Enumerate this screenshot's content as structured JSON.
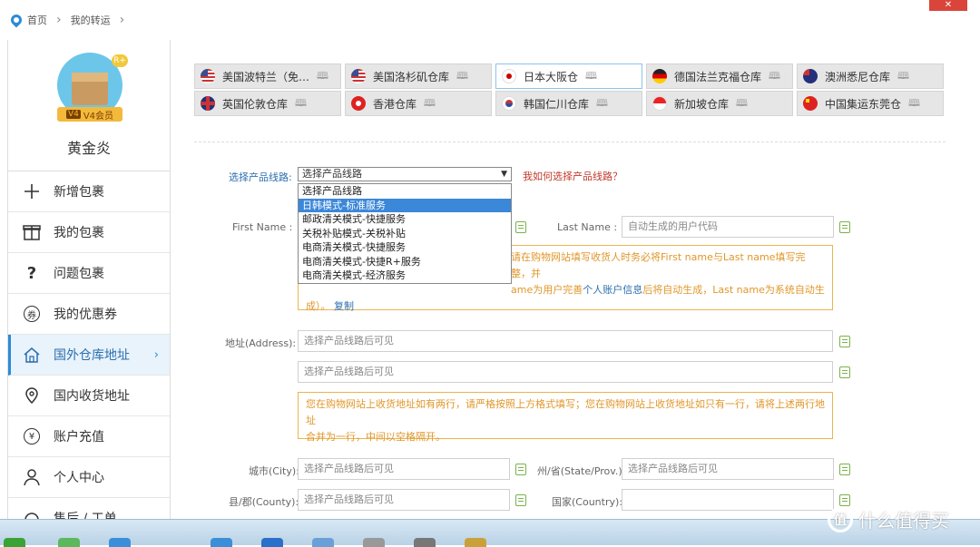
{
  "breadcrumb": {
    "home": "首页",
    "current": "我的转运"
  },
  "user": {
    "badge": "R+",
    "vip_level": "V4",
    "vip_label": "V4会员",
    "name": "黄金炎"
  },
  "sidebar": {
    "items": [
      {
        "label": "新增包裹",
        "icon": "plus-icon"
      },
      {
        "label": "我的包裹",
        "icon": "package-icon"
      },
      {
        "label": "问题包裹",
        "icon": "question-icon"
      },
      {
        "label": "我的优惠券",
        "icon": "coupon-icon",
        "icon_char": "券"
      },
      {
        "label": "国外仓库地址",
        "icon": "house-icon",
        "active": true
      },
      {
        "label": "国内收货地址",
        "icon": "location-icon"
      },
      {
        "label": "账户充值",
        "icon": "yen-icon",
        "icon_char": "¥"
      },
      {
        "label": "个人中心",
        "icon": "person-icon"
      },
      {
        "label": "售后 / 工单",
        "icon": "headset-icon"
      }
    ]
  },
  "warehouse_tabs": [
    {
      "label": "美国波特兰（免…",
      "flag": "flag-us-icon"
    },
    {
      "label": "美国洛杉矶仓库",
      "flag": "flag-us-icon"
    },
    {
      "label": "日本大阪仓",
      "flag": "flag-jp-icon",
      "active": true
    },
    {
      "label": "德国法兰克福仓库",
      "flag": "flag-de-icon"
    },
    {
      "label": "澳洲悉尼仓库",
      "flag": "flag-au-icon"
    },
    {
      "label": "英国伦敦仓库",
      "flag": "flag-uk-icon"
    },
    {
      "label": "香港仓库",
      "flag": "flag-hk-icon"
    },
    {
      "label": "韩国仁川仓库",
      "flag": "flag-kr-icon"
    },
    {
      "label": "新加坡仓库",
      "flag": "flag-sg-icon"
    },
    {
      "label": "中国集运东莞仓",
      "flag": "flag-cn-icon"
    }
  ],
  "route": {
    "label": "选择产品线路:",
    "selected": "选择产品线路",
    "help_link": "我如何选择产品线路？",
    "options": [
      "选择产品线路",
      "日韩模式-标准服务",
      "邮政清关模式-快捷服务",
      "关税补贴模式-关税补贴",
      "电商清关模式-快捷服务",
      "电商清关模式-快捷R+服务",
      "电商清关模式-经济服务"
    ],
    "highlighted_index": 1
  },
  "form": {
    "first_name_label": "First Name :",
    "last_name_label": "Last Name :",
    "last_name_placeholder": "自动生成的用户代码",
    "name_note_line1": "请在购物网站填写收货人时务必将First name与Last name填写完整，并",
    "name_note_line2_prefix": "ame为用户完善",
    "name_note_link1": "个人账户信息",
    "name_note_line2_suffix": "后将自动生成，Last name为系统自动生",
    "name_note_line3": "成）。",
    "name_note_copy": "复制",
    "address_label": "地址(Address):",
    "address_placeholder1": "选择产品线路后可见",
    "address_placeholder2": "选择产品线路后可见",
    "address_note_line1": "您在购物网站上收货地址如有两行，请严格按照上方格式填写；您在购物网站上收货地址如只有一行，请将上述两行地址",
    "address_note_line2": "合并为一行，中间以空格隔开。",
    "city_label": "城市(City):",
    "city_placeholder": "选择产品线路后可见",
    "state_label": "州/省(State/Prov.):",
    "state_placeholder": "选择产品线路后可见",
    "county_label": "县/郡(County):",
    "county_placeholder": "选择产品线路后可见",
    "country_label": "国家(Country):"
  },
  "window": {
    "close_label": "✕"
  },
  "watermark": {
    "text": "什么值得买",
    "glyph": "值"
  }
}
